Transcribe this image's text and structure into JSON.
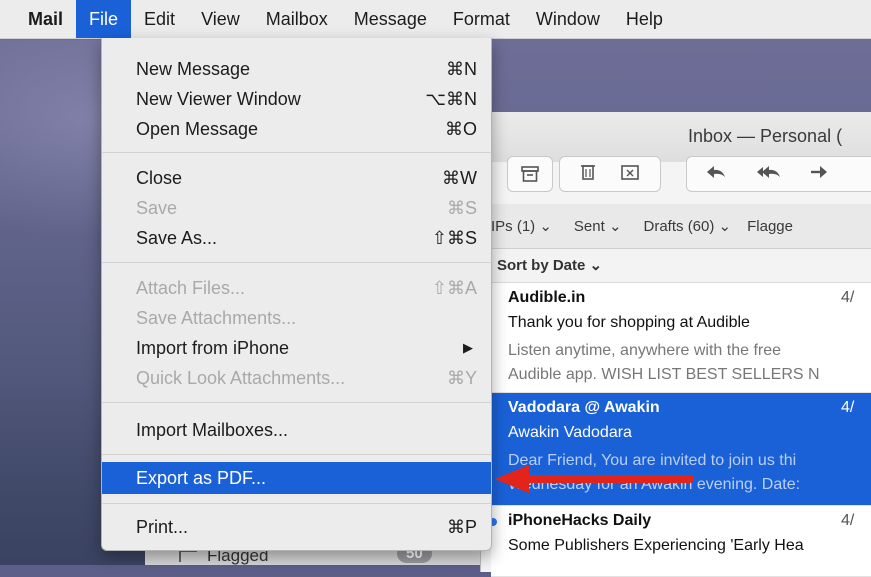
{
  "menubar": {
    "items": [
      "Mail",
      "File",
      "Edit",
      "View",
      "Mailbox",
      "Message",
      "Format",
      "Window",
      "Help"
    ],
    "active": "File"
  },
  "window": {
    "title": "Inbox — Personal (",
    "favorites": [
      "IPs (1) ⌄",
      "Sent ⌄",
      "Drafts (60) ⌄",
      "Flagge"
    ],
    "sort_label": "Sort by Date ⌄",
    "messages": [
      {
        "sender": "Audible.in",
        "date": "4/",
        "subject": "Thank you for shopping at Audible",
        "preview1": "Listen anytime, anywhere with the free",
        "preview2": "Audible app. WISH LIST BEST SELLERS N"
      },
      {
        "sender": "Vadodara @ Awakin",
        "date": "4/",
        "subject": "Awakin Vadodara",
        "preview1": "Dear Friend, You are invited to join us thi",
        "preview2": "Wednesday for an Awakin evening. Date:"
      },
      {
        "sender": "iPhoneHacks Daily",
        "date": "4/",
        "subject": "Some Publishers Experiencing 'Early Hea"
      }
    ]
  },
  "sidebar": {
    "flagged_label": "Flagged",
    "flagged_count": "50"
  },
  "file_menu": {
    "items": [
      {
        "label": "New Message",
        "shortcut": "⌘N"
      },
      {
        "label": "New Viewer Window",
        "shortcut": "⌥⌘N"
      },
      {
        "label": "Open Message",
        "shortcut": "⌘O"
      },
      {
        "label": "Close",
        "shortcut": "⌘W"
      },
      {
        "label": "Save",
        "shortcut": "⌘S"
      },
      {
        "label": "Save As...",
        "shortcut": "⇧⌘S"
      },
      {
        "label": "Attach Files...",
        "shortcut": "⇧⌘A"
      },
      {
        "label": "Save Attachments..."
      },
      {
        "label": "Import from iPhone",
        "shortcut": "▶"
      },
      {
        "label": "Quick Look Attachments...",
        "shortcut": "⌘Y"
      },
      {
        "label": "Import Mailboxes..."
      },
      {
        "label": "Export as PDF..."
      },
      {
        "label": "Print...",
        "shortcut": "⌘P"
      }
    ],
    "highlighted": "Export as PDF..."
  },
  "colors": {
    "accent": "#1a61d8",
    "annotation": "#e3241b"
  },
  "icons": [
    "archive-icon",
    "trash-icon",
    "junk-icon",
    "reply-icon",
    "reply-all-icon",
    "forward-icon",
    "flag-icon",
    "arrow-annotation-icon"
  ]
}
